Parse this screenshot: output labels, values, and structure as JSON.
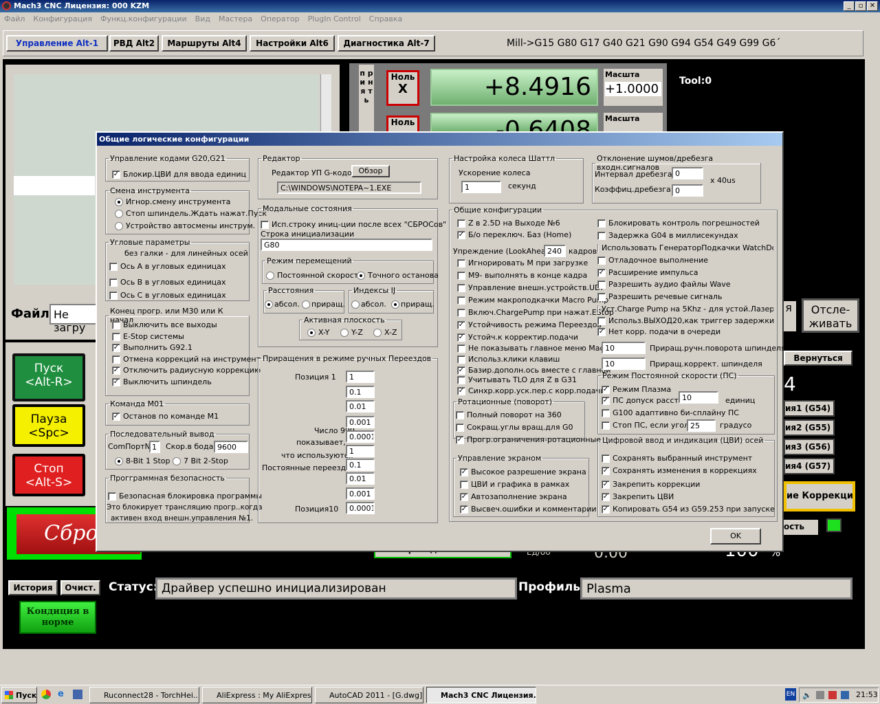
{
  "window": {
    "title": "Mach3 CNC  Лицензия: 000 KZM"
  },
  "menu": [
    "Файл",
    "Конфигурация",
    "Функц.конфигурации",
    "Вид",
    "Мастера",
    "Оператор",
    "PlugIn Control",
    "Справка"
  ],
  "tabs": [
    "Управление Alt-1",
    "РВД Alt2",
    "Маршруты Alt4",
    "Настройки Alt6",
    "Диагностика Alt-7"
  ],
  "gcodes": "Mill->G15  G80 G17 G40 G21 G90 G94 G54 G49 G99 G6´",
  "main": {
    "rail_label": "п р и н я т ь",
    "zero_x": "Ноль",
    "zero_x_axis": "X",
    "zero_y": "Ноль",
    "dro_x": "+8.4916",
    "dro_y": "-0.6408",
    "scale_label": "Масшта",
    "scale_value": "+1.0000",
    "tool": "Tool:0",
    "file_label": "Файл:",
    "file_value": "Не загру",
    "run": "Пуск",
    "run_key": "<Alt-R>",
    "pause": "Пауза",
    "pause_key": "<Spc>",
    "stop": "Стоп",
    "stop_key": "<Alt-S>",
    "reset": "Сбро",
    "track_partial": "я",
    "track": "Отсле-\nживать",
    "return": "Вернуться",
    "g54": "ия1 (G54)",
    "g55": "ия2 (G55)",
    "g56": "ия3 (G56)",
    "g57": "ия4 (G57)",
    "corrections": "ие Коррекции",
    "speed_partial": "ость",
    "four": "4",
    "bottom_btn": "Переезды Ctrl-Alt-6",
    "ed_label": "Ед/об",
    "ed_value": "0.00",
    "percent": "100",
    "percent_sign": "%"
  },
  "status": {
    "history": "История",
    "clear": "Очист.",
    "status_label": "Статус:",
    "status_value": "Драйвер успешно инициализирован",
    "profile_label": "Профиль:",
    "profile_value": "Plasma",
    "condition": "Кондиция в норме"
  },
  "taskbar": {
    "start": "Пуск",
    "items": [
      "Ruconnect28 - TorchHei...",
      "AliExpress : My AliExpres...",
      "AutoCAD 2011 - [G.dwg]",
      "Mach3 CNC  Лицензия..."
    ],
    "lang": "EN",
    "time": "21:53"
  },
  "dialog": {
    "title": "Общие логические конфигурации",
    "g20": {
      "legend": "Управление кодами G20,G21",
      "items": [
        {
          "label": "Блокир.ЦВИ для ввода единиц",
          "checked": true
        }
      ]
    },
    "toolchange": {
      "legend": "Смена инструмента",
      "items": [
        {
          "label": "Игнор.смену инструмента",
          "on": true
        },
        {
          "label": "Стоп шпиндель.Ждать нажат.Пуск",
          "on": false
        },
        {
          "label": "Устройство автосмены инструм.",
          "on": false
        }
      ]
    },
    "angular": {
      "legend": "Угловые параметры",
      "note": "без галки - для линейных осей",
      "items": [
        {
          "label": "Ось А в угловых единицах",
          "checked": false
        },
        {
          "label": "Ось В в угловых единицах",
          "checked": false
        },
        {
          "label": "Ось С в угловых единицах",
          "checked": false
        }
      ]
    },
    "endprog": {
      "legend": "Конец прогр. или М30 или К начал",
      "items": [
        {
          "label": "Выключить все выходы",
          "checked": false
        },
        {
          "label": "E-Stop системы",
          "checked": false
        },
        {
          "label": "Выполнить G92.1",
          "checked": true
        },
        {
          "label": "Отмена коррекций на инструмент",
          "checked": false
        },
        {
          "label": "Отключить радиусную коррекцию",
          "checked": true
        },
        {
          "label": "Выключить шпиндель",
          "checked": true
        }
      ]
    },
    "m01": {
      "legend": "Команда М01",
      "items": [
        {
          "label": "Останов по команде М1",
          "checked": true
        }
      ]
    },
    "serial": {
      "legend": "Последовательный вывод",
      "port_label": "ComПортN°",
      "port": "1",
      "baud_label": "Скор.в бодах",
      "baud": "9600",
      "opt1": "8-Bit 1 Stop",
      "opt2": "7 Bit 2-Stop"
    },
    "safety": {
      "legend": "Прогграммная безопасность",
      "item": "Безопасная блокировка программы",
      "note1": "Это блокирует трансляцию прогр..когда",
      "note2": "активен вход внешн.управления №1."
    },
    "editor": {
      "legend": "Редактор",
      "label": "Редактор УП G-кодов",
      "browse": "Обзор",
      "path": "C:\\WINDOWS\\NOTEPA~1.EXE"
    },
    "modal": {
      "legend": "Модальные состояния",
      "init_item": "Исп.строку иниц-ции после всех \"СБРОСов\"",
      "init_label": "Строка инициализации",
      "init_value": "G80"
    },
    "motion": {
      "legend": "Режим перемещений",
      "opt1": "Постоянной скорости",
      "opt2": "Точного останова"
    },
    "dist": {
      "legend": "Расстояния",
      "opt1": "абсол.",
      "opt2": "приращ."
    },
    "ij": {
      "legend": "Индексы IJ",
      "opt1": "абсол.",
      "opt2": "приращ."
    },
    "plane": {
      "legend": "Активная плоскость",
      "opt1": "X-Y",
      "opt2": "Y-Z",
      "opt3": "X-Z"
    },
    "jog": {
      "legend": "Приращения в режиме ручных Переездов",
      "pos1": "Позиция 1",
      "pos10": "Позиция10",
      "note1": "Число 999",
      "note2": "показывает,",
      "note3": "что используются",
      "note4": "Постоянные переезды",
      "values": [
        "1",
        "0.1",
        "0.01",
        "0.001",
        "0.0001",
        "1",
        "0.1",
        "0.01",
        "0.001",
        "0.0001"
      ]
    },
    "wheel": {
      "legend": "Настройка колеса Шаттл",
      "accel": "Ускорение колеса",
      "value": "1",
      "unit": "секунд"
    },
    "debounce": {
      "legend": "Отклонение шумов/дребезга входн.сигналов",
      "interval": "Интервал дребезга:",
      "interval_value": "0",
      "coef": "Коэффиц.дребезга",
      "coef_value": "0",
      "unit": "x 40us"
    },
    "general": {
      "legend": "Общие конфигурации",
      "left": [
        {
          "label": "Z в 2.5D на Выходе №6",
          "checked": false
        },
        {
          "label": "Б/о переключ. Баз (Home)",
          "checked": true
        }
      ],
      "lookahead_label": "Упреждение (LookAhead)",
      "lookahead": "240",
      "lookahead_unit": "кадров",
      "left2": [
        {
          "label": "Игнорировать М при загрузке",
          "checked": false
        },
        {
          "label": "M9- выполнять в конце кадра",
          "checked": false
        },
        {
          "label": "Управление внешн.устройств.UDP",
          "checked": false
        },
        {
          "label": "Режим макроподкачки Macro Pump",
          "checked": false
        },
        {
          "label": "Включ.ChargePump при нажат.EStop",
          "checked": false
        },
        {
          "label": "Устойчивость режима Переездов",
          "checked": true
        },
        {
          "label": "Устойч.к корректир.подачи",
          "checked": true
        },
        {
          "label": "Не показывать главное меню Mach3",
          "checked": false
        },
        {
          "label": "Использ.клики клавиш",
          "checked": false
        },
        {
          "label": "Базир.дополн.ось вместе с главной",
          "checked": true
        },
        {
          "label": "Учитывать TLO для Z в G31",
          "checked": false
        },
        {
          "label": "Синхр.корр.уск.пер.с корр.подачи",
          "checked": true
        }
      ],
      "right": [
        {
          "label": "Блокировать контроль погрешностей",
          "checked": false
        },
        {
          "label": "Задержка G04 в миллисекундах",
          "checked": false
        },
        {
          "label": "Использовать ГенераторПодкачки WatchDogs",
          "checked": false
        },
        {
          "label": "Отладочное выполнение",
          "checked": false
        },
        {
          "label": "Расширение импульса",
          "checked": true
        },
        {
          "label": "Разрешить аудио файлы Wave",
          "checked": false
        },
        {
          "label": "Разрешить речевые сигналь",
          "checked": false
        },
        {
          "label": "Уст.Charge Pump на 5Khz - для устой.Лазера",
          "checked": false
        },
        {
          "label": "Использ.ВЫХОД20,как триггер задержки",
          "checked": false
        },
        {
          "label": "Нет корр. подачи в очереди",
          "checked": true
        }
      ],
      "spin1_value": "10",
      "spin1_label": "Приращ.ручн.поворота шпинделя",
      "spin2_value": "10",
      "spin2_label": "Приращ.коррект. шпинделя"
    },
    "rotation": {
      "legend": "Ротационные (поворот)",
      "items": [
        {
          "label": "Полный поворот на 360",
          "checked": false
        },
        {
          "label": "Сокращ.углы вращ.для G0",
          "checked": false
        },
        {
          "label": "Прогр.ограничения-ротационные",
          "checked": true
        }
      ]
    },
    "screen": {
      "legend": "Управление экраном",
      "items": [
        {
          "label": "Высокое разрешение экрана",
          "checked": true
        },
        {
          "label": "ЦВИ и графика в рамках",
          "checked": false
        },
        {
          "label": "Автозаполнение экрана",
          "checked": true
        },
        {
          "label": "Высвеч.ошибки и комментарии",
          "checked": true
        }
      ]
    },
    "cv": {
      "legend": "Режим Постоянной скорости (ПС)",
      "plasma": "Режим Плазма",
      "tol_label": "ПС допуск расст.",
      "tol": "10",
      "tol_unit": "единиц",
      "g100": "G100 адаптивно би-сплайну ПС",
      "angle_label": "Стоп ПС, если угол >",
      "angle": "25",
      "angle_unit": "градусо"
    },
    "dro": {
      "legend": "Цифровой ввод и индикация (ЦВИ) осей",
      "items": [
        {
          "label": "Сохранять выбранный инструмент",
          "checked": false
        },
        {
          "label": "Сохранять изменения в коррекциях",
          "checked": true
        },
        {
          "label": "Закрепить коррекции",
          "checked": true
        },
        {
          "label": "Закрепить ЦВИ",
          "checked": true
        },
        {
          "label": "Копировать G54 из G59.253 при запуске",
          "checked": true
        }
      ]
    },
    "ok": "OK"
  }
}
